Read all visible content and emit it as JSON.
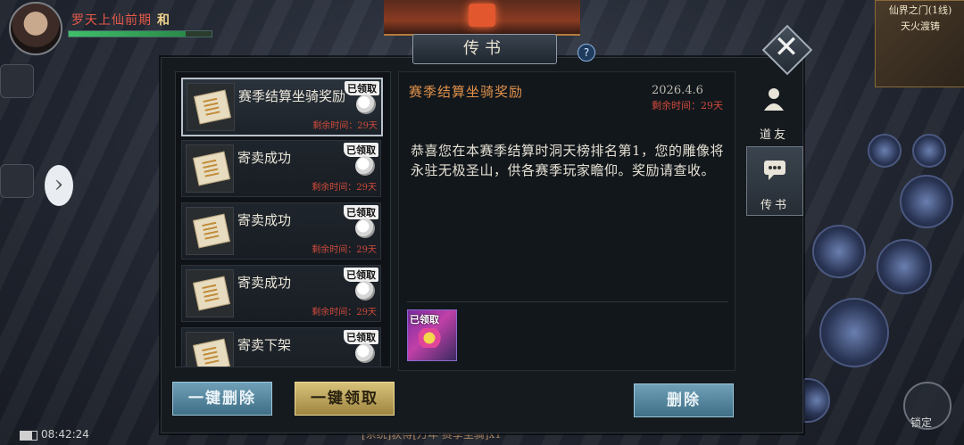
{
  "player": {
    "name": "罗天上仙前期",
    "tag": "和",
    "hp_fraction": 0.82
  },
  "minimap": {
    "location": "仙界之门(1线)",
    "area": "天火渡铸"
  },
  "dialog": {
    "title": "传书",
    "help_symbol": "?",
    "close_symbol": "✕"
  },
  "side_tabs": [
    {
      "label": "道友",
      "icon": "friend-icon"
    },
    {
      "label": "传书",
      "icon": "mail-chat-icon",
      "active": true
    }
  ],
  "mail_list": [
    {
      "title": "赛季结算坐骑奖励",
      "claimed": "已领取",
      "remaining": "剩余时间：29天",
      "selected": true
    },
    {
      "title": "寄卖成功",
      "claimed": "已领取",
      "remaining": "剩余时间：29天"
    },
    {
      "title": "寄卖成功",
      "claimed": "已领取",
      "remaining": "剩余时间：29天"
    },
    {
      "title": "寄卖成功",
      "claimed": "已领取",
      "remaining": "剩余时间：29天"
    },
    {
      "title": "寄卖下架",
      "claimed": "已领取",
      "remaining": "剩余时间：29天"
    }
  ],
  "detail": {
    "title": "赛季结算坐骑奖励",
    "date": "2026.4.6",
    "remaining": "剩余时间：29天",
    "body": "恭喜您在本赛季结算时洞天榜排名第1，您的雕像将永驻无极圣山，供各赛季玩家瞻仰。奖励请查收。",
    "reward": {
      "claimed": "已领取",
      "icon": "mount-reward-icon"
    }
  },
  "buttons": {
    "delete_all": "一键删除",
    "claim_all": "一键领取",
    "delete": "删除"
  },
  "status": {
    "time": "08:42:24",
    "lock": "锁定",
    "chat": "[系统]获得[万年·赛季坐骑]x1"
  },
  "colors": {
    "accent_title": "#e0904a",
    "remaining_red": "#d14a3c",
    "blue_button": "#5a8ba2",
    "gold_button": "#c4ac60"
  }
}
